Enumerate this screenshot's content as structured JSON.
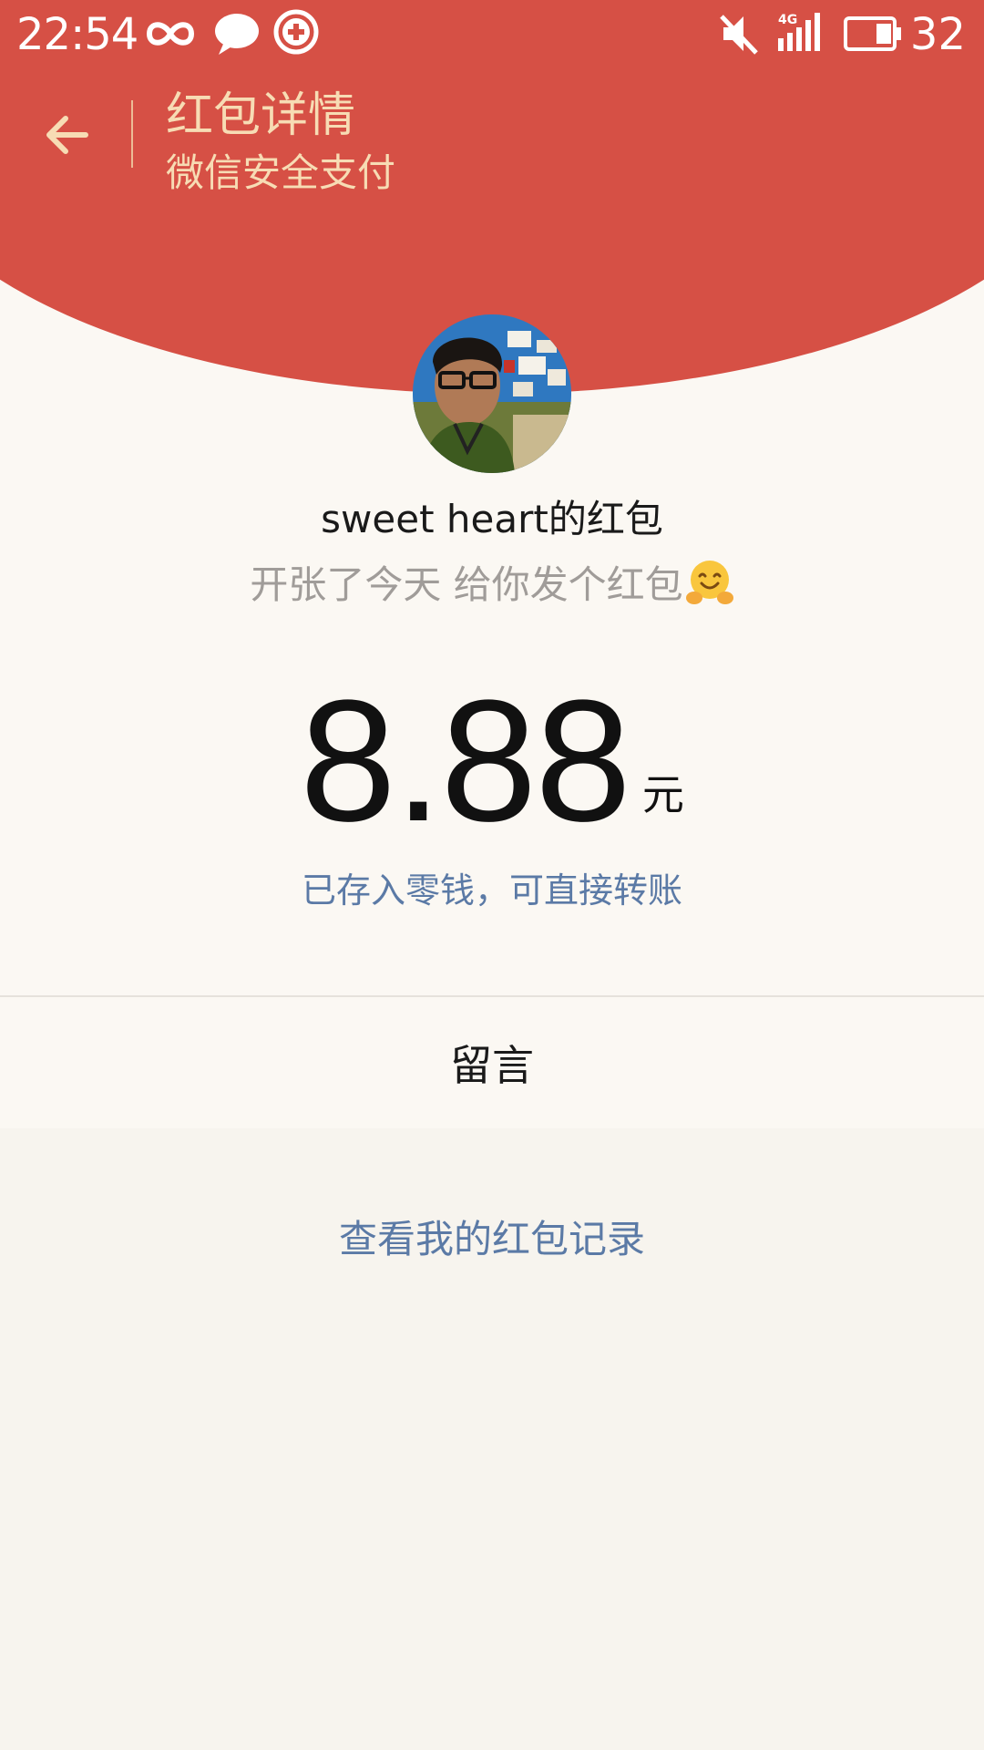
{
  "status_bar": {
    "time": "22:54",
    "battery_level": "32",
    "network": "4G",
    "icons": [
      "infinity-icon",
      "chat-bubble-icon",
      "medical-app-icon",
      "mute-icon",
      "signal-icon",
      "battery-icon"
    ]
  },
  "app_bar": {
    "title": "红包详情",
    "subtitle": "微信安全支付",
    "back_icon": "back-arrow-icon"
  },
  "red_packet": {
    "sender_label": "sweet heart的红包",
    "greeting": "开张了今天 给你发个红包",
    "greeting_emoji": "hug-smile-emoji",
    "amount": "8.88",
    "unit": "元",
    "deposit_note": "已存入零钱，可直接转账"
  },
  "actions": {
    "message_label": "留言",
    "records_link": "查看我的红包记录"
  },
  "colors": {
    "header_red": "#d65045",
    "title_gold": "#f7dcb4",
    "link_blue": "#5b7aa6",
    "background": "#f7f4ee"
  }
}
